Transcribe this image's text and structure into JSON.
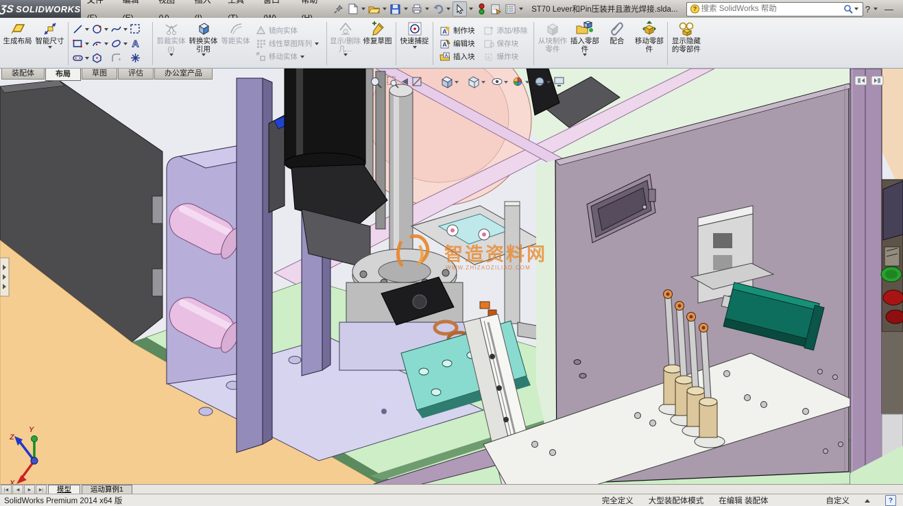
{
  "titlebar": {
    "logo_prefix": "ƷS",
    "logo_text": "SOLIDWORKS",
    "menus": [
      "文件(F)",
      "编辑(E)",
      "视图(V)",
      "插入(I)",
      "工具(T)",
      "窗口(W)",
      "帮助(H)"
    ],
    "document_title": "ST70 Lever和Pin压装并且激光焊接.slda...",
    "search_placeholder": "搜索 SolidWorks 帮助"
  },
  "ribbon": {
    "generate_layout": "生成布局",
    "smart_dimension": "智能尺寸",
    "trim_entities": "剪裁实体(I)",
    "convert_entities": "转换实体引用",
    "offset_entities": "等距实体",
    "mirror_entities": "镜向实体",
    "linear_sketch_pattern": "线性草图阵列",
    "move_entities": "移动实体",
    "display_delete_relations": "显示/删除几...",
    "repair_sketch": "修复草图",
    "quick_snaps": "快速捕捉",
    "make_block": "制作块",
    "edit_block": "编辑块",
    "insert_block": "插入块",
    "add_remove": "添加/移除",
    "save_block": "保存块",
    "explode_block": "爆炸块",
    "make_part_from_block": "从块制作零件",
    "insert_components": "插入零部件",
    "mate": "配合",
    "move_component": "移动零部件",
    "show_hidden_components": "显示隐藏的零部件"
  },
  "command_tabs": [
    "装配体",
    "布局",
    "草图",
    "评估",
    "办公室产品"
  ],
  "viewport": {
    "watermark_title": "智造资料网",
    "watermark_url": "WWW.ZHIZAOZILIAO.COM",
    "triad_x": "X",
    "triad_y": "Y",
    "triad_z": "Z"
  },
  "bottom": {
    "model_tab": "模型",
    "motion_tab": "运动算例1",
    "status_left": "SolidWorks Premium 2014 x64 版",
    "status_defined": "完全定义",
    "status_mode": "大型装配体模式",
    "status_editing": "在编辑 装配体",
    "status_customize": "自定义"
  },
  "colors": {
    "frame_purple": "#9a92c0",
    "cabinet_mauve": "#a99bac",
    "floor_tan": "#f5cd90",
    "platform_green": "#cdeec6",
    "table_salmon": "#f8dad2",
    "actuator_teal": "#0e6e5d",
    "pin_copper": "#e0914f",
    "watermark_orange": "#e8872b"
  }
}
